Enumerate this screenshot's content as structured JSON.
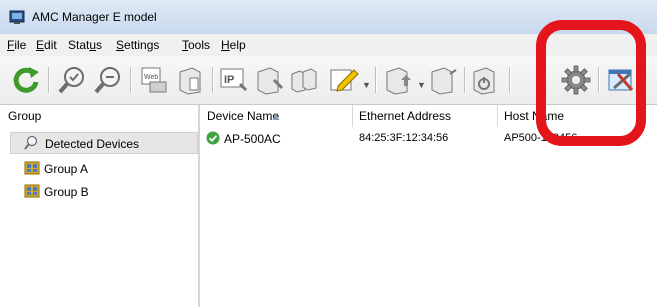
{
  "window": {
    "title": "AMC Manager E model"
  },
  "menu": {
    "items": [
      {
        "label": "File",
        "accel": "F"
      },
      {
        "label": "Edit",
        "accel": "E"
      },
      {
        "label": "Status",
        "accel": "u"
      },
      {
        "label": "Settings",
        "accel": "S"
      },
      {
        "label": "Tools",
        "accel": "T"
      },
      {
        "label": "Help",
        "accel": "H"
      }
    ]
  },
  "toolbar": {
    "buttons": [
      {
        "name": "refresh-icon"
      },
      {
        "name": "search-device-icon"
      },
      {
        "name": "search-remove-icon"
      },
      {
        "name": "web-config-icon"
      },
      {
        "name": "device-properties-icon"
      },
      {
        "name": "ip-settings-icon"
      },
      {
        "name": "device-settings-icon"
      },
      {
        "name": "group-settings-icon"
      },
      {
        "name": "edit-icon"
      },
      {
        "name": "firmware-update-icon"
      },
      {
        "name": "device-add-icon"
      },
      {
        "name": "device-restart-icon"
      },
      {
        "name": "gear-icon"
      },
      {
        "name": "tools-icon"
      }
    ]
  },
  "left_panel": {
    "header": "Group",
    "items": [
      {
        "label": "Detected Devices",
        "icon": "search-icon",
        "selected": true
      },
      {
        "label": "Group A",
        "icon": "group-icon",
        "selected": false
      },
      {
        "label": "Group B",
        "icon": "group-icon",
        "selected": false
      }
    ]
  },
  "grid": {
    "columns": [
      "Device Name",
      "Ethernet Address",
      "Host Name"
    ],
    "rows": [
      {
        "device_name": "AP-500AC",
        "ethernet": "84:25:3F:12:34:56",
        "host": "AP500-123456",
        "status_icon": "check-icon"
      }
    ]
  },
  "colors": {
    "highlight": "#e4151b",
    "accent": "#2f7bd3",
    "ok_green": "#3fa33f"
  }
}
